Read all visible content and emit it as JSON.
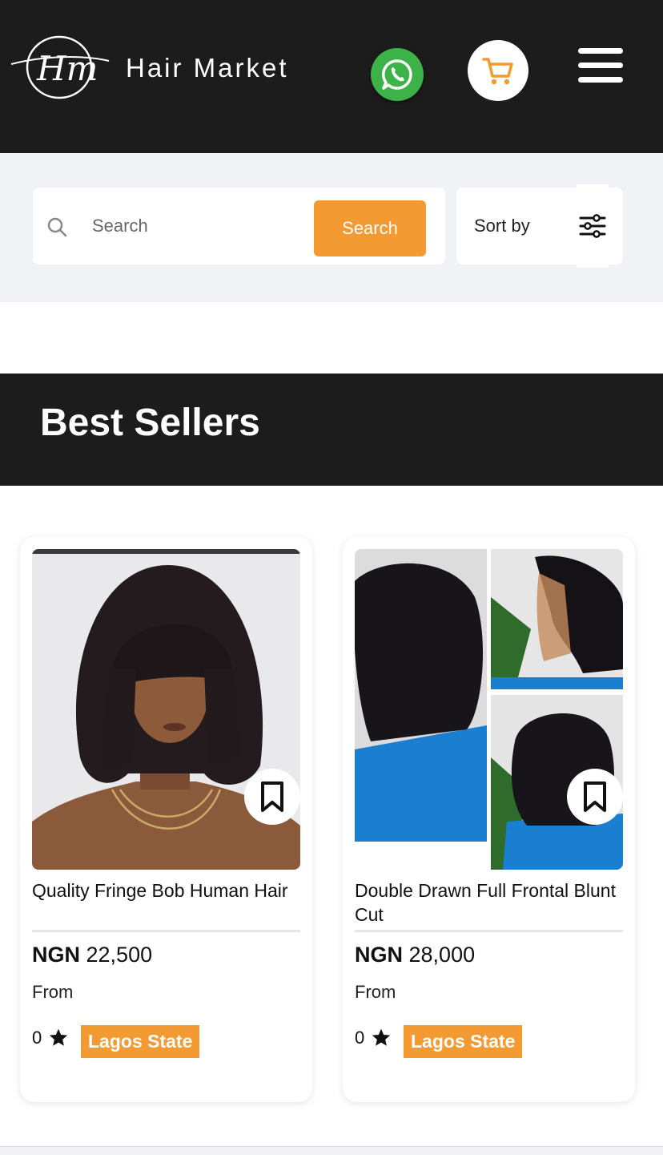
{
  "header": {
    "brand": "Hair Market",
    "logo_text": "Hm",
    "colors": {
      "background": "#1c1c1c",
      "whatsapp": "#3db249",
      "accent": "#f39a32"
    },
    "icons": {
      "whatsapp": "whatsapp-icon",
      "cart": "cart-icon",
      "menu": "hamburger-menu-icon"
    }
  },
  "search": {
    "placeholder": "Search",
    "button_label": "Search",
    "sort_label": "Sort by"
  },
  "best_sellers": {
    "title": "Best Sellers",
    "products": [
      {
        "name": "Quality Fringe Bob Human Hair",
        "currency": "NGN",
        "price": "22,500",
        "price_note": "From",
        "rating": "0",
        "location": "Lagos State"
      },
      {
        "name": "Double Drawn Full Frontal Blunt Cut",
        "currency": "NGN",
        "price": "28,000",
        "price_note": "From",
        "rating": "0",
        "location": "Lagos State"
      }
    ]
  }
}
